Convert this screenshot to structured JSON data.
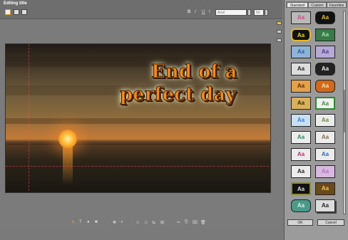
{
  "window": {
    "title": "Editing title"
  },
  "toolbar": {
    "bold": "B",
    "italic": "I",
    "underline": "U",
    "strike": "I",
    "font": "Arial",
    "size": "50"
  },
  "caption": {
    "line1": "End of a",
    "line2": "perfect day"
  },
  "panel": {
    "tabs": [
      "Standard",
      "Custom",
      "Favorites"
    ],
    "swatch_text": "Aa",
    "ok": "OK",
    "cancel": "Cancel"
  },
  "icons": {
    "text_tool": "T",
    "bottom_glyphs": [
      "✎",
      "T",
      "●",
      "■",
      "✥",
      "◖",
      "⊂",
      "⊃",
      "⇆",
      "⊞",
      "✂",
      "⎘",
      "⌧",
      "🗑"
    ]
  }
}
